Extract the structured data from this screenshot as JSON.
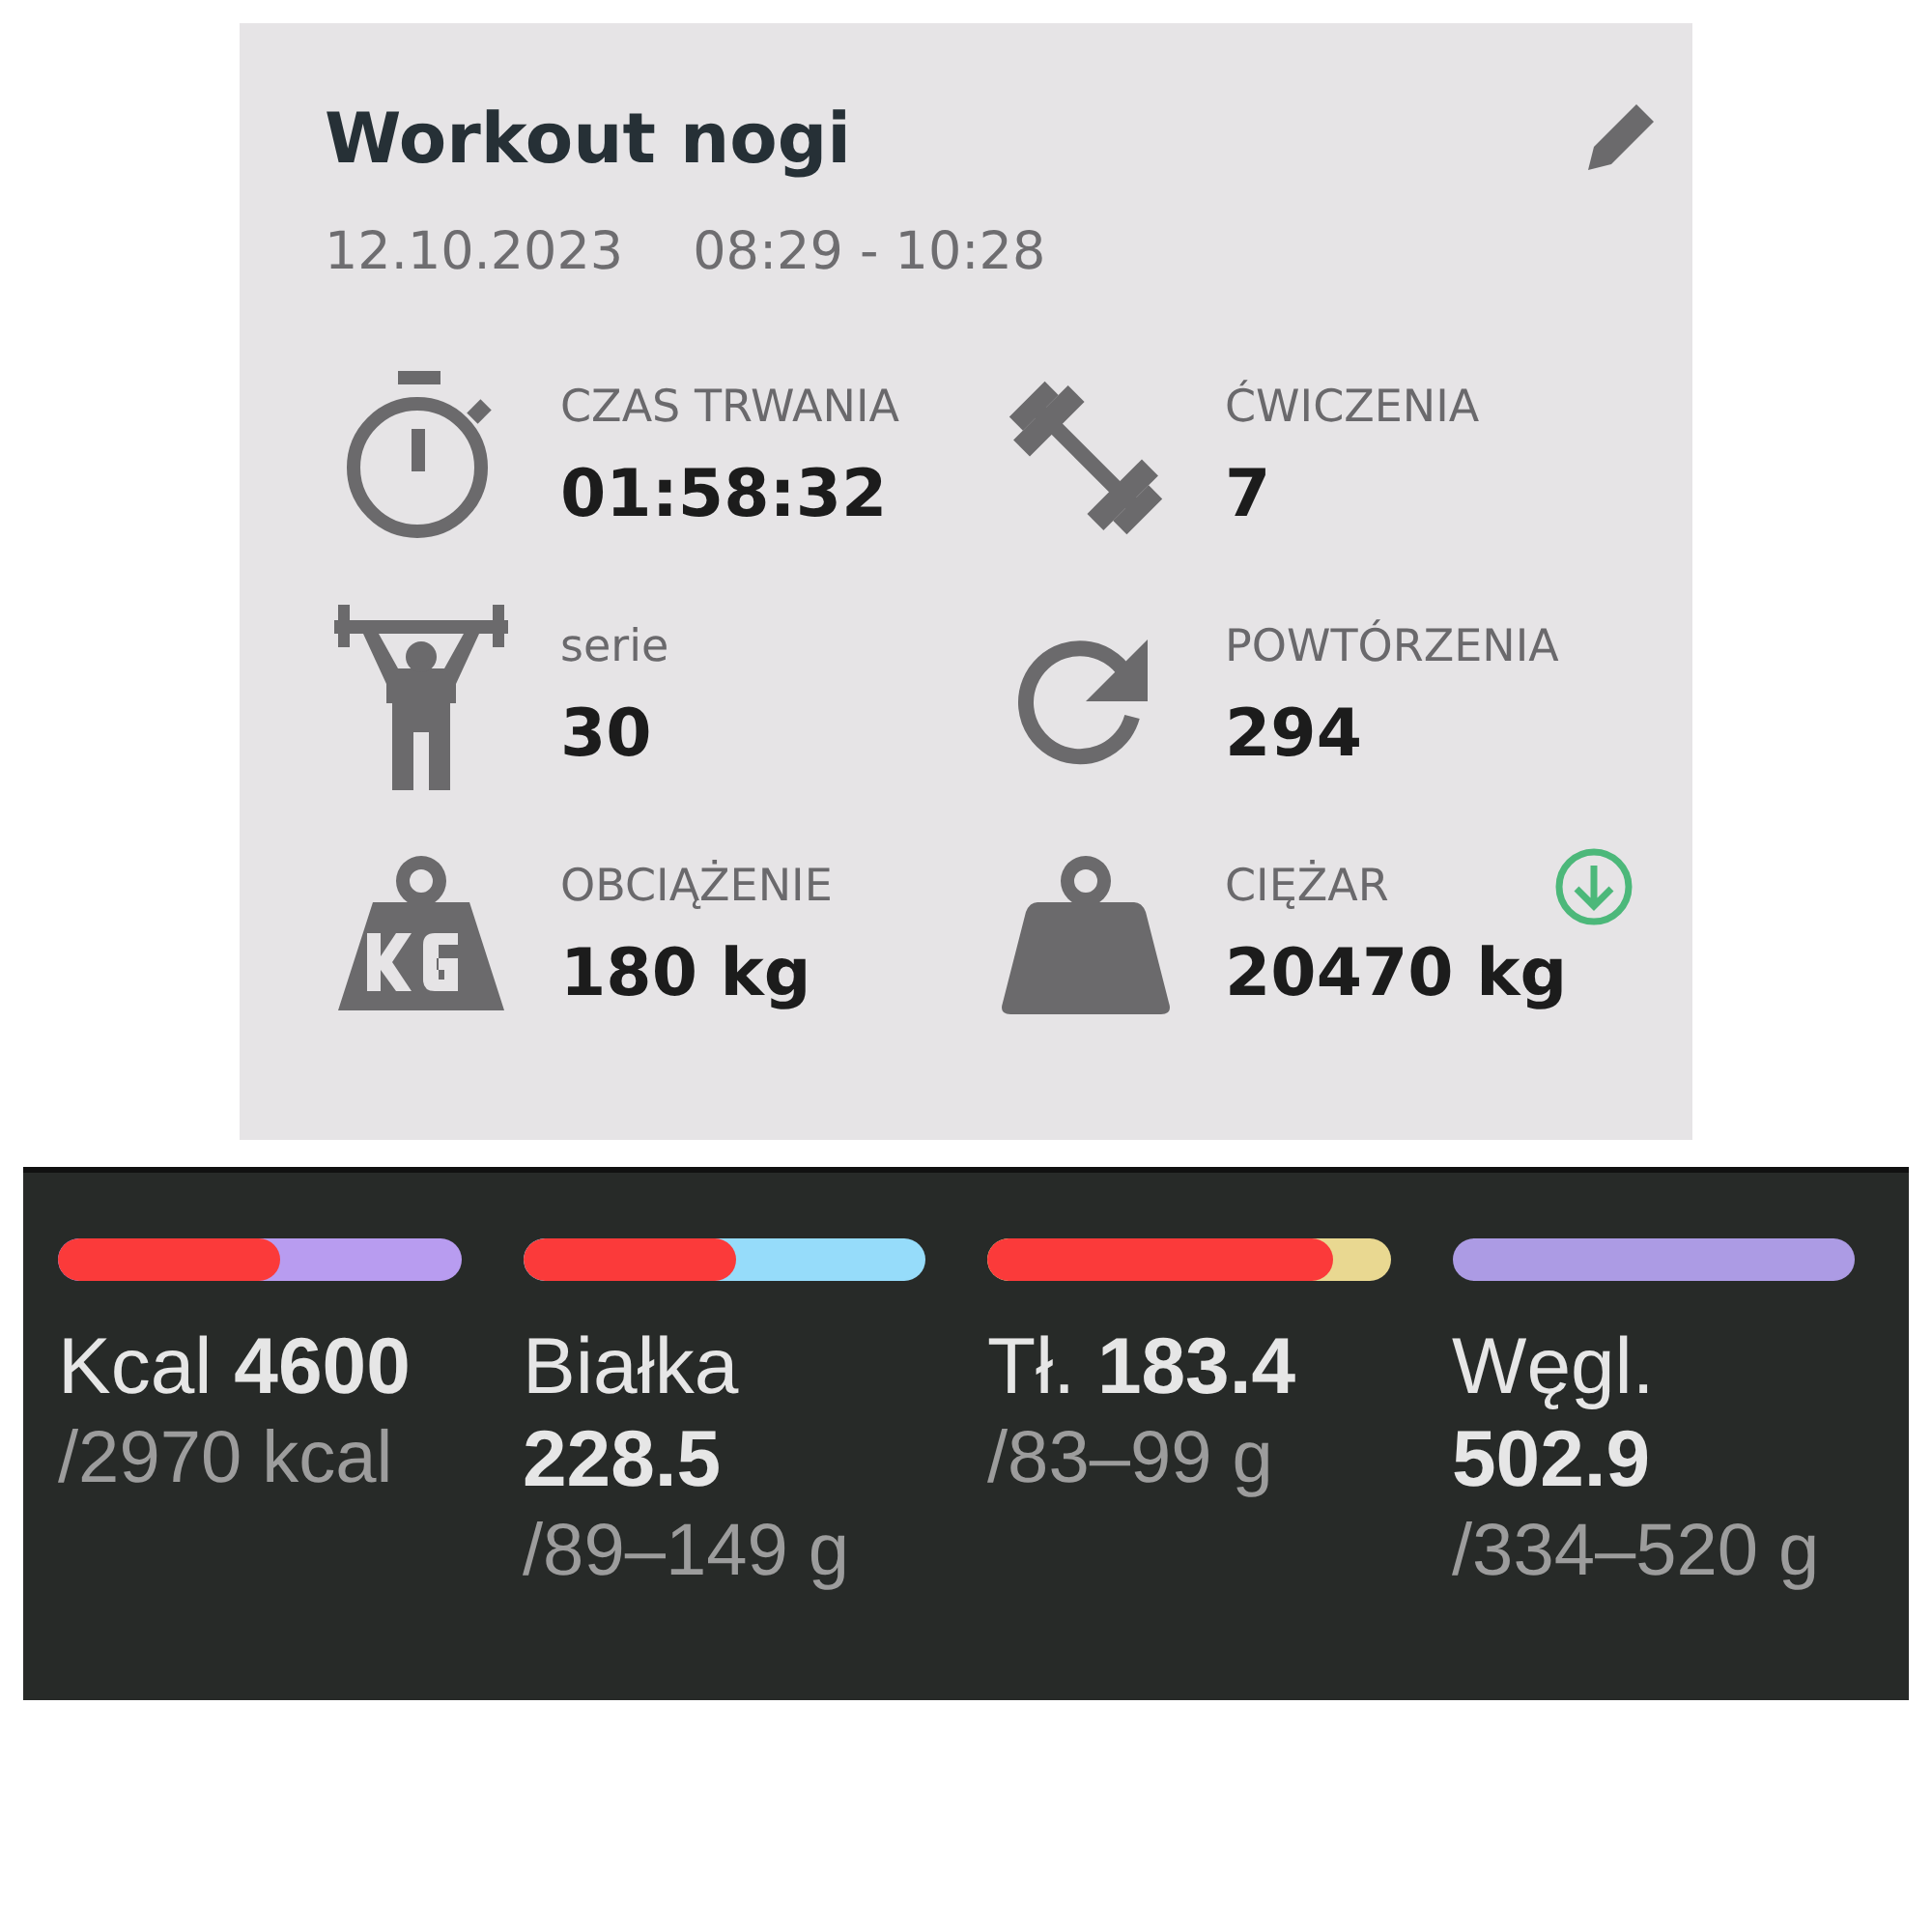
{
  "workout": {
    "title": "Workout nogi",
    "date": "12.10.2023",
    "time": "08:29 - 10:28",
    "stats": [
      {
        "kind": "stopwatch",
        "label": "CZAS TRWANIA",
        "value": "01:58:32"
      },
      {
        "kind": "barbell",
        "label": "ĆWICZENIA",
        "value": "7"
      },
      {
        "kind": "lifter",
        "label": "serie",
        "value": "30"
      },
      {
        "kind": "repeat",
        "label": "POWTÓRZENIA",
        "value": "294"
      },
      {
        "kind": "kg-weight",
        "label": "OBCIĄŻENIE",
        "value": "180 kg"
      },
      {
        "kind": "weight",
        "label": "CIĘŻAR",
        "value": "20470 kg",
        "download": true
      }
    ]
  },
  "nutrition": [
    {
      "label": "Kcal",
      "value": "4600",
      "target": "/2970 kcal",
      "level": 0.55,
      "color": "#b89cf0"
    },
    {
      "label": "Białka",
      "value": "228.5",
      "target": "/89–149 g",
      "level": 0.53,
      "color": "#96dcfa"
    },
    {
      "label": "Tł.",
      "value": "183.4",
      "target": "/83–99 g",
      "level": 0.86,
      "color": "#e9d891"
    },
    {
      "label": "Węgl.",
      "value": "502.9",
      "target": "/334–520 g",
      "level": 0,
      "color": "#ac9be4"
    }
  ]
}
